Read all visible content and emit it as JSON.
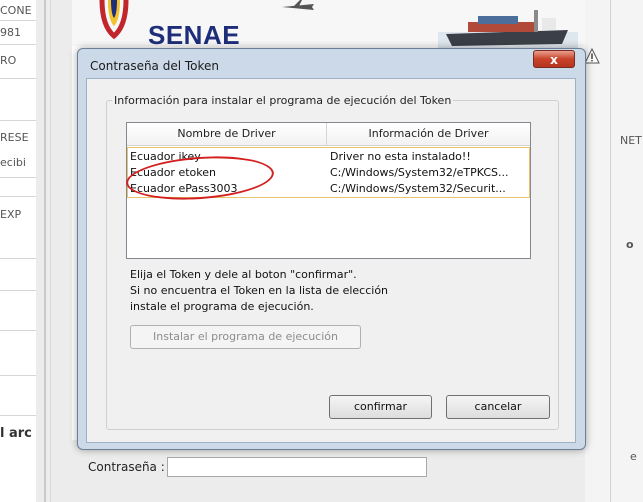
{
  "background": {
    "left_fragments": [
      "CONE",
      "981",
      "RO",
      "RESE",
      "ecibi",
      "EXP",
      "l arc"
    ],
    "right_fragments": [
      "NET",
      "o",
      "e"
    ],
    "banner_logo_text": "SENAE",
    "password_label": "Contraseña :",
    "password_value": ""
  },
  "dialog": {
    "title": "Contraseña del Token",
    "close_label": "x",
    "group_title": "Información para instalar el programa de ejecución del Token",
    "list": {
      "columns": [
        "Nombre de Driver",
        "Información de Driver"
      ],
      "rows": [
        {
          "name": "Ecuador ikey",
          "info": "Driver no esta instalado!!"
        },
        {
          "name": "Ecuador etoken",
          "info": "C:/Windows/System32/eTPKCS..."
        },
        {
          "name": "Ecuador ePass3003",
          "info": "C:/Windows/System32/Securit..."
        }
      ]
    },
    "instructions": [
      "Elija el Token y dele al boton \"confirmar\".",
      "Si no encuentra el Token en la lista de elección",
      "instale el programa de ejecución."
    ],
    "install_button": "Instalar el programa de ejecución",
    "confirm_button": "confirmar",
    "cancel_button": "cancelar"
  },
  "colors": {
    "dialog_frame": "#ccd9e8",
    "close_button": "#c9432b",
    "highlight_ellipse": "#d41f1f",
    "row_outline": "#e8c56a",
    "logo_text": "#1e2e7a"
  }
}
